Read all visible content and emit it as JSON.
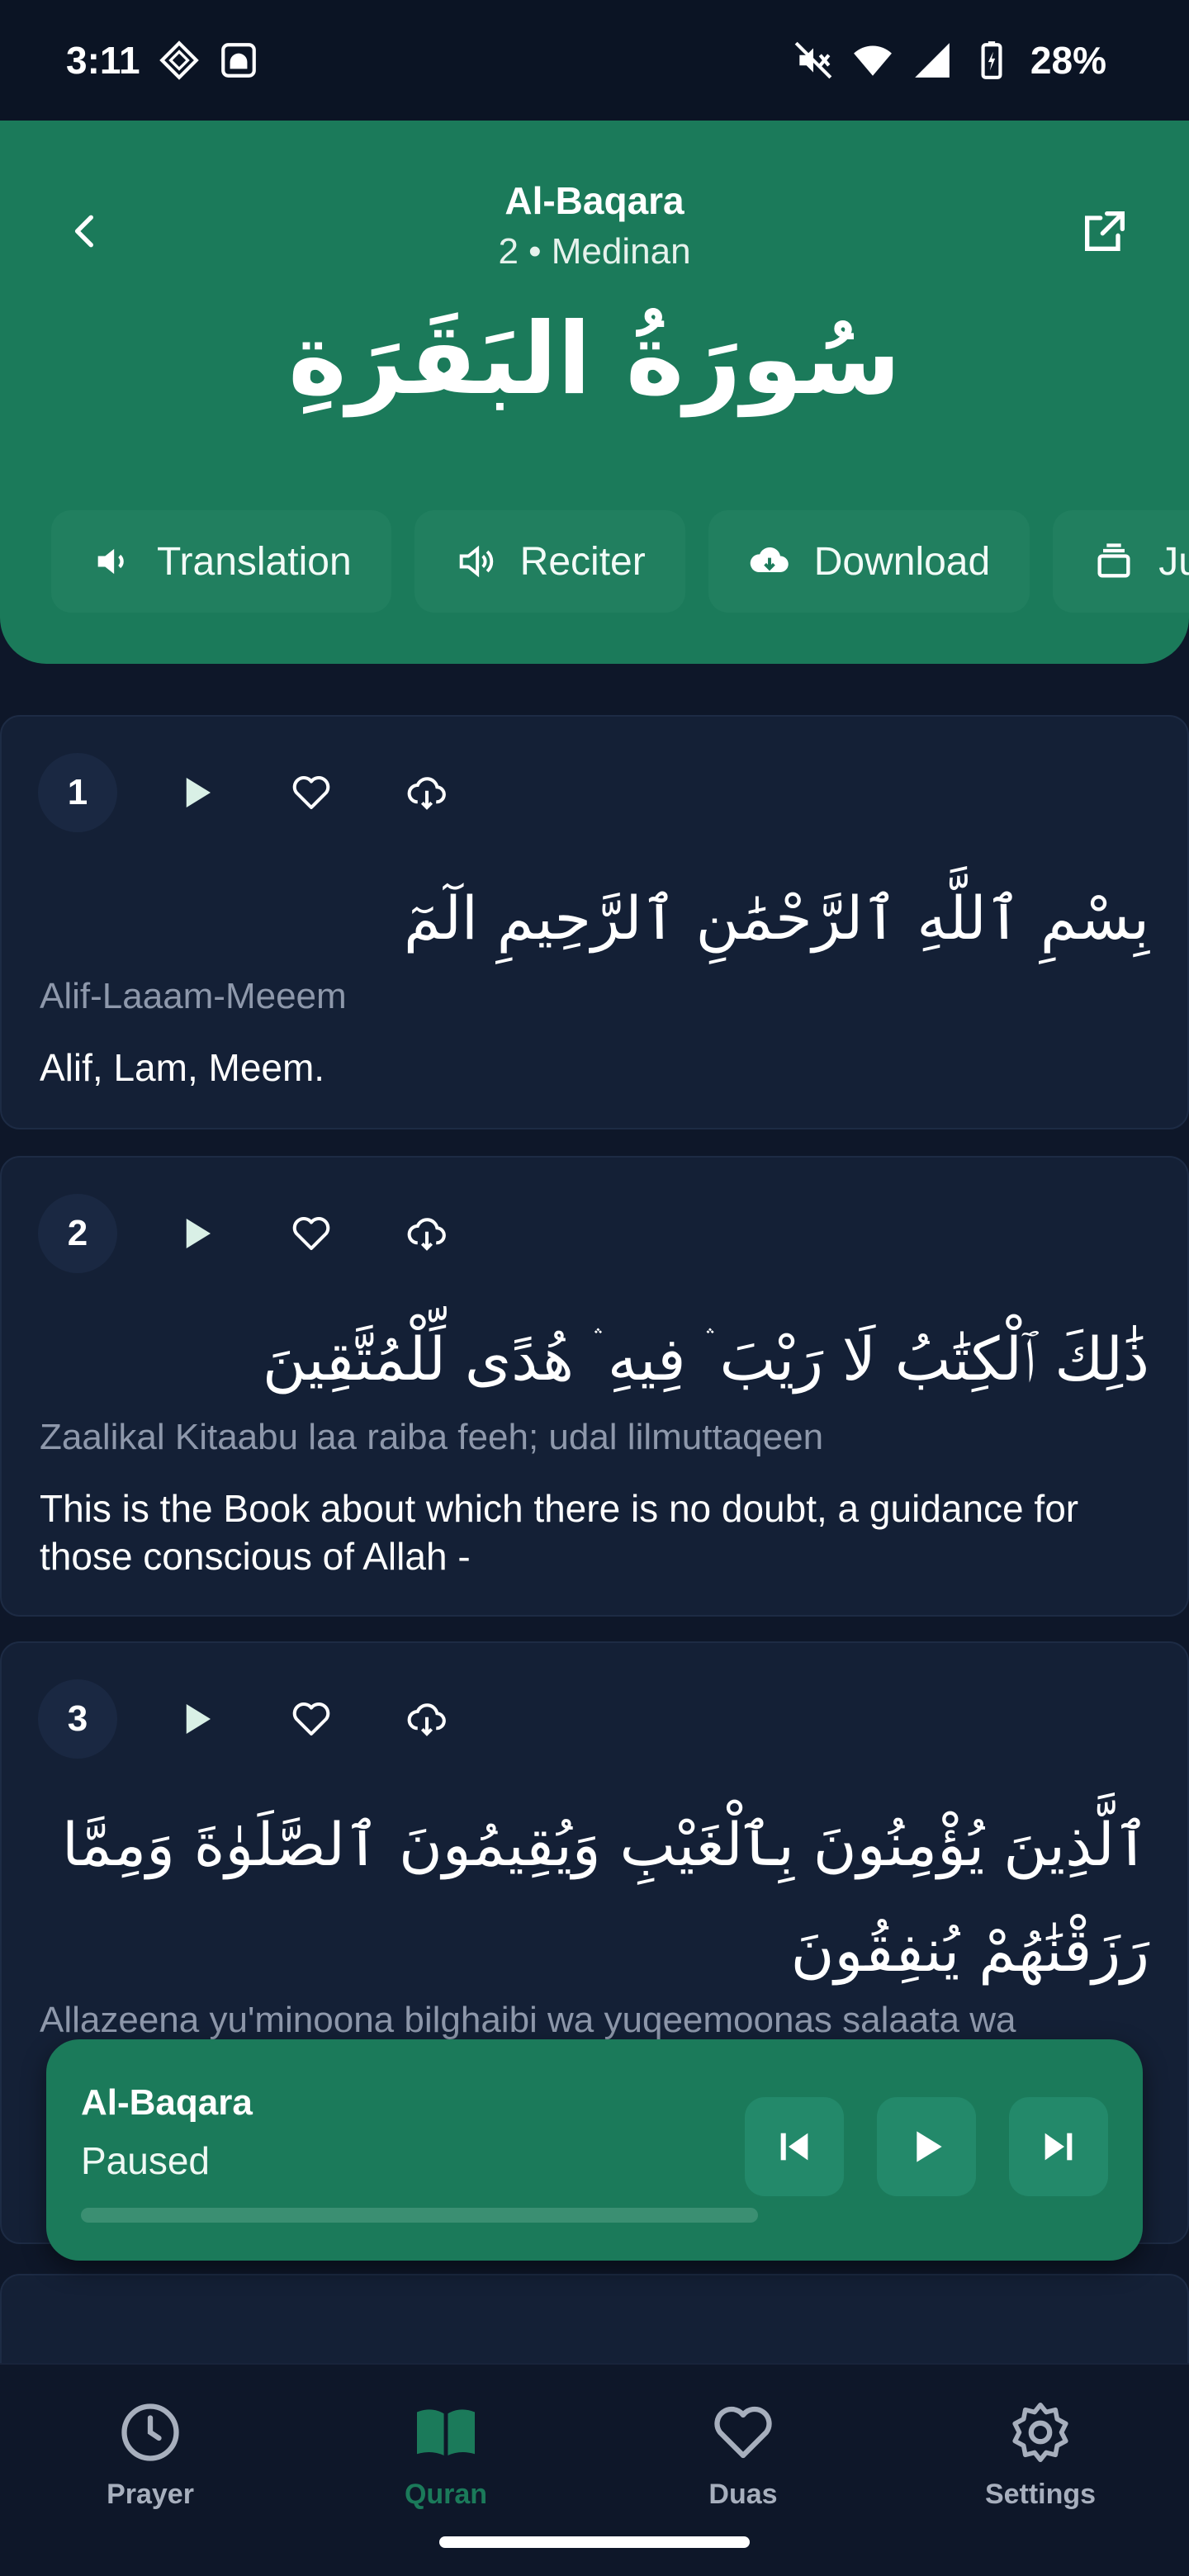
{
  "status_bar": {
    "time": "3:11",
    "battery": "28%"
  },
  "header": {
    "title": "Al-Baqara",
    "subtitle": "2 • Medinan",
    "arabic_title": "سُورَةُ البَقَرَةِ",
    "chips": [
      {
        "label": "Translation",
        "icon": "speaker-icon"
      },
      {
        "label": "Reciter",
        "icon": "reciter-icon"
      },
      {
        "label": "Download",
        "icon": "cloud-download-icon"
      },
      {
        "label": "Ju",
        "icon": "juz-icon"
      }
    ]
  },
  "verses": [
    {
      "number": "1",
      "arabic": "بِسْمِ ٱللَّهِ ٱلرَّحْمَٰنِ ٱلرَّحِيمِ الٓمٓ",
      "transliteration": "Alif-Laaam-Meeem",
      "translation": "Alif, Lam, Meem."
    },
    {
      "number": "2",
      "arabic": "ذَٰلِكَ ٱلْكِتَٰبُ لَا رَيْبَ ۛ فِيهِ ۛ هُدًى لِّلْمُتَّقِينَ",
      "transliteration": "Zaalikal Kitaabu laa raiba feeh; udal lilmuttaqeen",
      "translation": "This is the Book about which there is no doubt, a guidance for those conscious of Allah -"
    },
    {
      "number": "3",
      "arabic": "ٱلَّذِينَ يُؤْمِنُونَ بِٱلْغَيْبِ وَيُقِيمُونَ ٱلصَّلَوٰةَ وَمِمَّا رَزَقْنَٰهُمْ يُنفِقُونَ",
      "transliteration": "Allazeena yu'minoona bilghaibi wa yuqeemoonas salaata wa",
      "translation": ""
    }
  ],
  "player": {
    "title": "Al-Baqara",
    "status": "Paused",
    "progress": 0
  },
  "nav": {
    "items": [
      {
        "label": "Prayer",
        "icon": "clock-icon",
        "active": false
      },
      {
        "label": "Quran",
        "icon": "book-icon",
        "active": true
      },
      {
        "label": "Duas",
        "icon": "heart-icon",
        "active": false
      },
      {
        "label": "Settings",
        "icon": "gear-icon",
        "active": false
      }
    ]
  },
  "colors": {
    "accent": "#1b7a5a",
    "background": "#0e1729",
    "card": "#142036"
  }
}
